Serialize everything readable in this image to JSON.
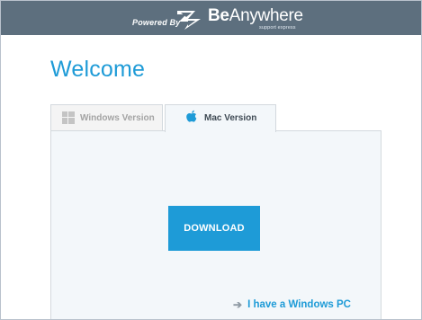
{
  "header": {
    "powered_by": "Powered By",
    "brand_bold": "Be",
    "brand_rest": "Anywhere",
    "tagline": "support express"
  },
  "main": {
    "title": "Welcome",
    "tabs": [
      {
        "label": "Windows Version",
        "icon": "windows-icon",
        "active": false
      },
      {
        "label": "Mac Version",
        "icon": "apple-icon",
        "active": true
      }
    ],
    "download_label": "DOWNLOAD",
    "alt_link_arrow": "➔",
    "alt_link_label": "I have a Windows PC"
  },
  "colors": {
    "accent": "#1e9bd7",
    "header_bg": "#5d6f7e",
    "panel_bg": "#f3f7fa"
  }
}
